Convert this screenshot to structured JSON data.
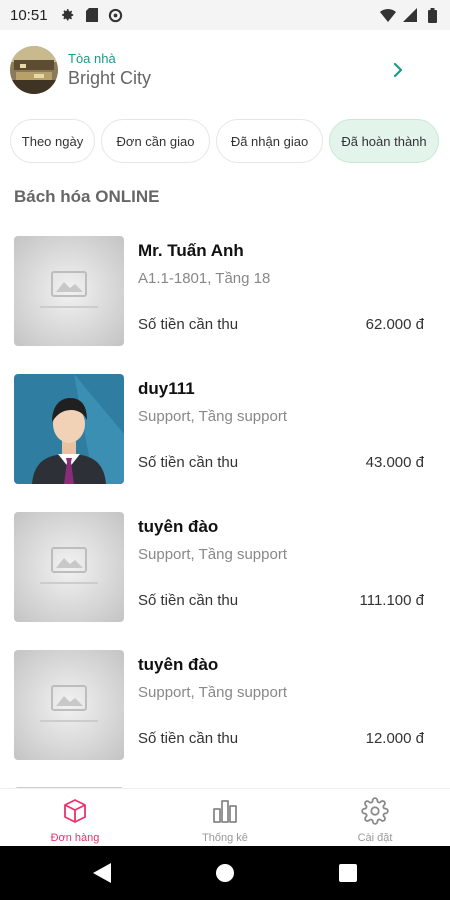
{
  "status_bar": {
    "time": "10:51",
    "icons": [
      "settings-icon",
      "sd-card-icon",
      "data-saver-icon",
      "wifi-icon",
      "signal-icon",
      "battery-icon"
    ]
  },
  "header": {
    "building_label": "Tòa nhà",
    "building_name": "Bright City"
  },
  "tabs": [
    {
      "label": "Theo ngày",
      "active": false
    },
    {
      "label": "Đơn cần giao",
      "active": false
    },
    {
      "label": "Đã nhận giao",
      "active": false
    },
    {
      "label": "Đã hoàn thành",
      "active": true
    }
  ],
  "section_title": "Bách hóa ONLINE",
  "orders": [
    {
      "name": "Mr. Tuấn Anh",
      "address": "A1.1-1801, Tầng 18",
      "amount_label": "Số tiền cần thu",
      "amount": "62.000 đ",
      "image": "no-image-placeholder"
    },
    {
      "name": "duy111",
      "address": "Support, Tầng support",
      "amount_label": "Số tiền cần thu",
      "amount": "43.000 đ",
      "image": "person-avatar"
    },
    {
      "name": "tuyên đào",
      "address": "Support, Tầng support",
      "amount_label": "Số tiền cần thu",
      "amount": "111.100 đ",
      "image": "no-image-placeholder"
    },
    {
      "name": "tuyên đào",
      "address": "Support, Tầng support",
      "amount_label": "Số tiền cần thu",
      "amount": "12.000 đ",
      "image": "no-image-placeholder"
    }
  ],
  "bottom_nav": [
    {
      "label": "Đơn hàng",
      "icon": "box-icon",
      "active": true
    },
    {
      "label": "Thống kê",
      "icon": "bar-chart-icon",
      "active": false
    },
    {
      "label": "Cài đặt",
      "icon": "gear-icon",
      "active": false
    }
  ],
  "colors": {
    "accent_green": "#1a9c86",
    "active_tab_bg": "#e3f4ea",
    "active_nav": "#e8336d"
  }
}
